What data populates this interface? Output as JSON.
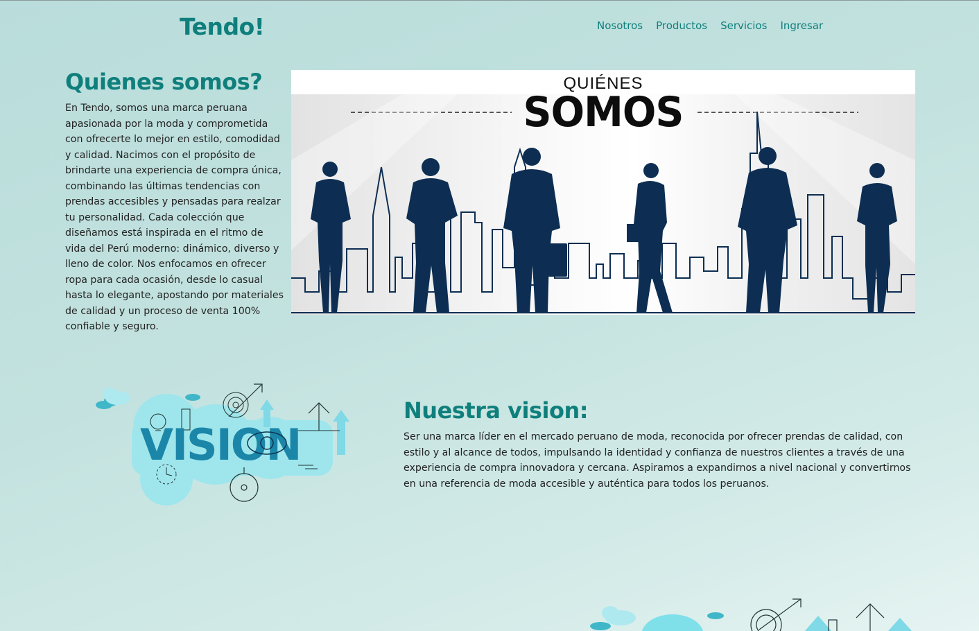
{
  "header": {
    "brand": "Tendo!",
    "nav": [
      {
        "label": "Nosotros"
      },
      {
        "label": "Productos"
      },
      {
        "label": "Servicios"
      },
      {
        "label": "Ingresar"
      }
    ]
  },
  "about": {
    "title": "Quienes somos?",
    "text": "En Tendo, somos una marca peruana apasionada por la moda y comprometida con ofrecerte lo mejor en estilo, comodidad y calidad. Nacimos con el propósito de brindarte una experiencia de compra única, combinando las últimas tendencias con prendas accesibles y pensadas para realzar tu personalidad. Cada colección que diseñamos está inspirada en el ritmo de vida del Perú moderno: dinámico, diverso y lleno de color. Nos enfocamos en ofrecer ropa para cada ocasión, desde lo casual hasta lo elegante, apostando por materiales de calidad y un proceso de venta 100% confiable y seguro.",
    "image": {
      "line1": "QUIÉNES",
      "line2": "SOMOS"
    }
  },
  "vision": {
    "title": "Nuestra vision:",
    "text": "Ser una marca líder en el mercado peruano de moda, reconocida por ofrecer prendas de calidad, con estilo y al alcance de todos, impulsando la identidad y confianza de nuestros clientes a través de una experiencia de compra innovadora y cercana. Aspiramos a expandirnos a nivel nacional y convertirnos en una referencia de moda accesible y auténtica para todos los peruanos.",
    "image_word": "VISION"
  },
  "colors": {
    "brand": "#0f7f7c",
    "silhouette": "#0d2e52",
    "vision_cyan": "#8fe3ea",
    "vision_blue": "#1b86a8"
  },
  "icons": [
    "cloud-icon",
    "lightbulb-icon",
    "target-icon",
    "arrow-up-icon",
    "clock-icon",
    "compass-icon",
    "eye-icon"
  ]
}
